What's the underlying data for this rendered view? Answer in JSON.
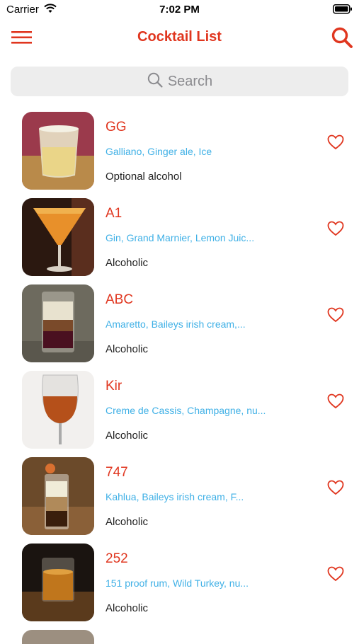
{
  "status": {
    "carrier": "Carrier",
    "time": "7:02 PM"
  },
  "nav": {
    "title": "Cocktail List"
  },
  "search": {
    "placeholder": "Search"
  },
  "colors": {
    "accent": "#e0361f",
    "ingredients": "#3fb0e6",
    "search_bg": "#ededed"
  },
  "cocktails": [
    {
      "name": "GG",
      "ingredients": "Galliano, Ginger ale, Ice",
      "category": "Optional alcohol"
    },
    {
      "name": "A1",
      "ingredients": "Gin, Grand Marnier, Lemon Juic...",
      "category": "Alcoholic"
    },
    {
      "name": "ABC",
      "ingredients": "Amaretto, Baileys irish cream,...",
      "category": "Alcoholic"
    },
    {
      "name": "Kir",
      "ingredients": "Creme de Cassis, Champagne, nu...",
      "category": "Alcoholic"
    },
    {
      "name": "747",
      "ingredients": "Kahlua, Baileys irish cream, F...",
      "category": "Alcoholic"
    },
    {
      "name": "252",
      "ingredients": "151 proof rum, Wild Turkey, nu...",
      "category": "Alcoholic"
    }
  ]
}
